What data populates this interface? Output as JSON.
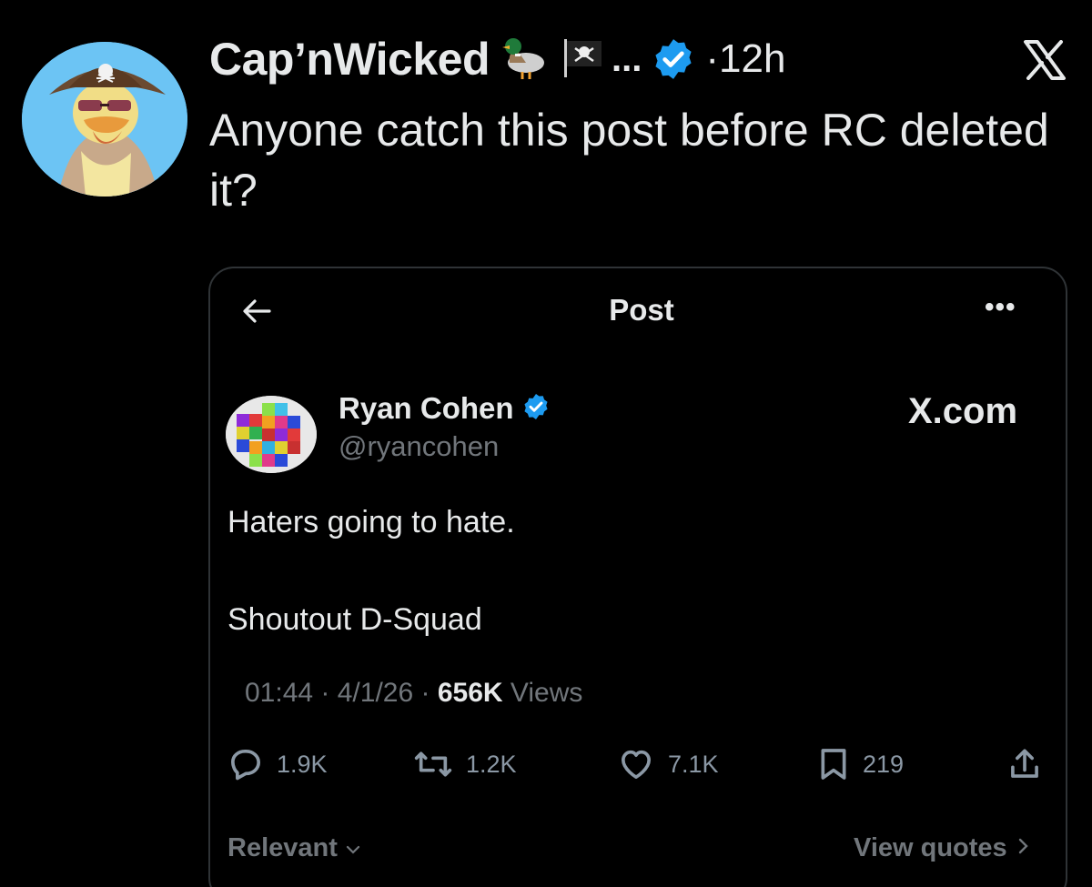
{
  "outer_post": {
    "display_name": "Cap’nWicked",
    "name_emojis": [
      "duck-emoji",
      "pirate-flag-emoji"
    ],
    "name_truncation": "...",
    "time": "12h",
    "separator": "·",
    "text": "Anyone catch this post before RC deleted it?",
    "platform_icon": "x-logo-icon"
  },
  "embedded_post": {
    "header_title": "Post",
    "author": {
      "name": "Ryan Cohen",
      "handle": "@ryancohen"
    },
    "brand_label": "X.com",
    "text_line1": "Haters going to hate.",
    "text_line2": "Shoutout D-Squad",
    "timestamp": "01:44",
    "date": "4/1/26",
    "views_count": "656K",
    "views_label": "Views",
    "actions": {
      "replies": "1.9K",
      "reposts": "1.2K",
      "likes": "7.1K",
      "bookmarks": "219"
    },
    "sort_label": "Relevant",
    "quotes_link": "View quotes"
  },
  "colors": {
    "background": "#000000",
    "text_primary": "#e7e9ea",
    "text_secondary": "#71767b",
    "verified_blue": "#1d9bf0",
    "card_border": "#2f3336"
  }
}
